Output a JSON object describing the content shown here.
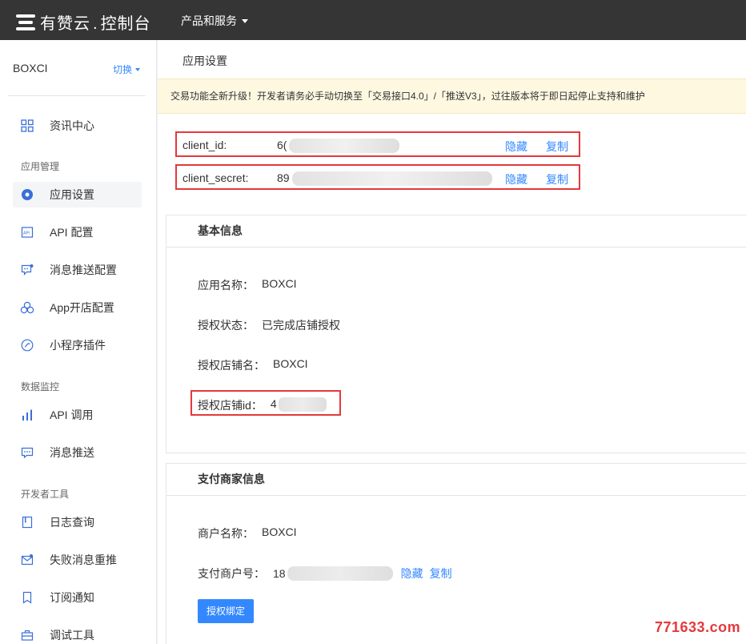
{
  "header": {
    "brand": "有赞云",
    "brand_sub": "控制台",
    "menu_label": "产品和服务"
  },
  "sidebar": {
    "account": "BOXCI",
    "switch_label": "切换",
    "items": [
      {
        "label": "资讯中心",
        "icon": "grid-icon"
      },
      {
        "label": "应用设置",
        "icon": "gear-icon"
      },
      {
        "label": "API 配置",
        "icon": "api-icon"
      },
      {
        "label": "消息推送配置",
        "icon": "message-config-icon"
      },
      {
        "label": "App开店配置",
        "icon": "app-store-icon"
      },
      {
        "label": "小程序插件",
        "icon": "plugin-icon"
      },
      {
        "label": "API 调用",
        "icon": "bar-chart-icon"
      },
      {
        "label": "消息推送",
        "icon": "chat-icon"
      },
      {
        "label": "日志查询",
        "icon": "log-icon"
      },
      {
        "label": "失败消息重推",
        "icon": "mail-retry-icon"
      },
      {
        "label": "订阅通知",
        "icon": "bookmark-icon"
      },
      {
        "label": "调试工具",
        "icon": "toolbox-icon"
      }
    ],
    "groups": [
      "应用管理",
      "数据监控",
      "开发者工具"
    ]
  },
  "main": {
    "title": "应用设置",
    "notice": "交易功能全新升级！开发者请务必手动切换至「交易接口4.0」/「推送V3」，过往版本将于即日起停止支持和维护",
    "client_id": {
      "label": "client_id:",
      "value": "6(",
      "hide": "隐藏",
      "copy": "复制"
    },
    "client_secret": {
      "label": "client_secret:",
      "value": "89",
      "hide": "隐藏",
      "copy": "复制"
    },
    "basic": {
      "title": "基本信息",
      "app_name_label": "应用名称：",
      "app_name": "BOXCI",
      "auth_status_label": "授权状态：",
      "auth_status": "已完成店铺授权",
      "shop_name_label": "授权店铺名：",
      "shop_name": "BOXCI",
      "shop_id_label": "授权店铺id：",
      "shop_id": "4"
    },
    "payment": {
      "title": "支付商家信息",
      "merchant_name_label": "商户名称：",
      "merchant_name": "BOXCI",
      "merchant_no_label": "支付商户号：",
      "merchant_no": "18",
      "hide": "隐藏",
      "copy": "复制",
      "bind_button": "授权绑定"
    }
  },
  "watermark": "771633.com",
  "colors": {
    "accent": "#3388ff",
    "highlight": "#e4393c",
    "topbar": "#353535",
    "notice_bg": "#fff8e1"
  }
}
